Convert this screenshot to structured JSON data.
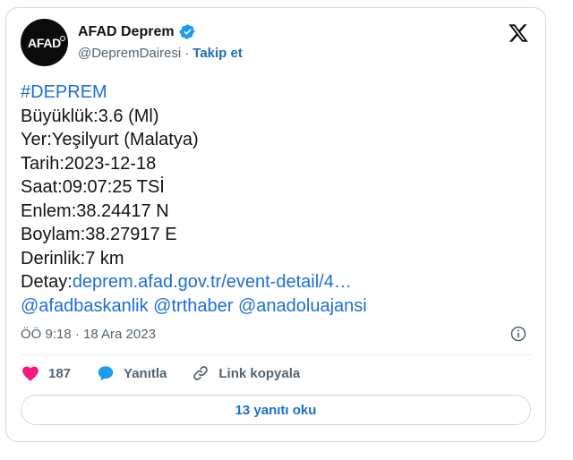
{
  "author": {
    "avatar_text": "AFAD",
    "name": "AFAD Deprem",
    "handle": "@DepremDairesi",
    "separator": "·",
    "follow_label": "Takip et"
  },
  "tweet": {
    "lines": [
      {
        "text": "#DEPREM",
        "kind": "link"
      },
      {
        "text": "Büyüklük:3.6 (Ml)",
        "kind": "text"
      },
      {
        "text": "Yer:Yeşilyurt (Malatya)",
        "kind": "text"
      },
      {
        "text": "Tarih:2023-12-18",
        "kind": "text"
      },
      {
        "text": "Saat:09:07:25 TSİ",
        "kind": "text"
      },
      {
        "text": "Enlem:38.24417 N",
        "kind": "text"
      },
      {
        "text": "Boylam:38.27917 E",
        "kind": "text"
      },
      {
        "text": "Derinlik:7 km",
        "kind": "text"
      }
    ],
    "detail_prefix": "Detay:",
    "detail_link": "deprem.afad.gov.tr/event-detail/4…",
    "mentions": [
      "@afadbaskanlik",
      "@trthaber",
      "@anadoluajansi"
    ]
  },
  "meta": {
    "time": "ÖÖ 9:18 · 18 Ara 2023"
  },
  "actions": {
    "likes": "187",
    "reply_label": "Yanıtla",
    "copy_link_label": "Link kopyala"
  },
  "read_replies_label": "13 yanıtı oku",
  "colors": {
    "link": "#1d6fd0",
    "heart": "#f91880",
    "reply": "#1d9bf0",
    "verified": "#1d9bf0"
  }
}
